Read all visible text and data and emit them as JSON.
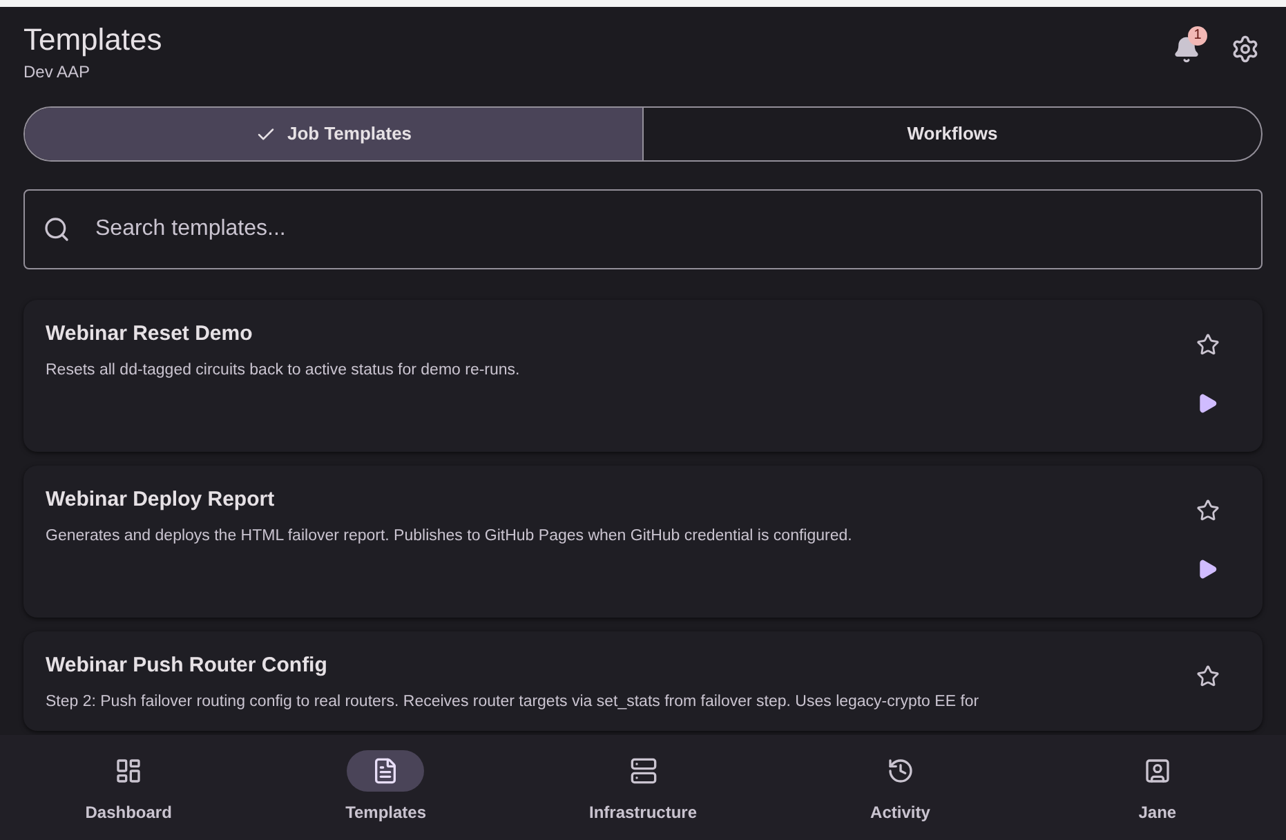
{
  "header": {
    "title": "Templates",
    "subtitle": "Dev AAP",
    "notification_count": "1"
  },
  "tabs": [
    {
      "label": "Job Templates",
      "selected": true
    },
    {
      "label": "Workflows",
      "selected": false
    }
  ],
  "search": {
    "placeholder": "Search templates..."
  },
  "templates": [
    {
      "name": "Webinar Reset Demo",
      "description": "Resets all dd-tagged circuits back to active status for demo re-runs.",
      "favorite": false,
      "launchable": true
    },
    {
      "name": "Webinar Deploy Report",
      "description": "Generates and deploys the HTML failover report. Publishes to GitHub Pages when GitHub credential is configured.",
      "favorite": false,
      "launchable": true
    },
    {
      "name": "Webinar Push Router Config",
      "description": "Step 2: Push failover routing config to real routers. Receives router targets via set_stats from failover step. Uses legacy-crypto EE for",
      "favorite": false,
      "launchable": false
    }
  ],
  "nav": [
    {
      "label": "Dashboard",
      "kind": "dashboard",
      "selected": false
    },
    {
      "label": "Templates",
      "kind": "templates",
      "selected": true
    },
    {
      "label": "Infrastructure",
      "kind": "infrastructure",
      "selected": false
    },
    {
      "label": "Activity",
      "kind": "activity",
      "selected": false
    },
    {
      "label": "Jane",
      "kind": "profile",
      "selected": false
    }
  ]
}
